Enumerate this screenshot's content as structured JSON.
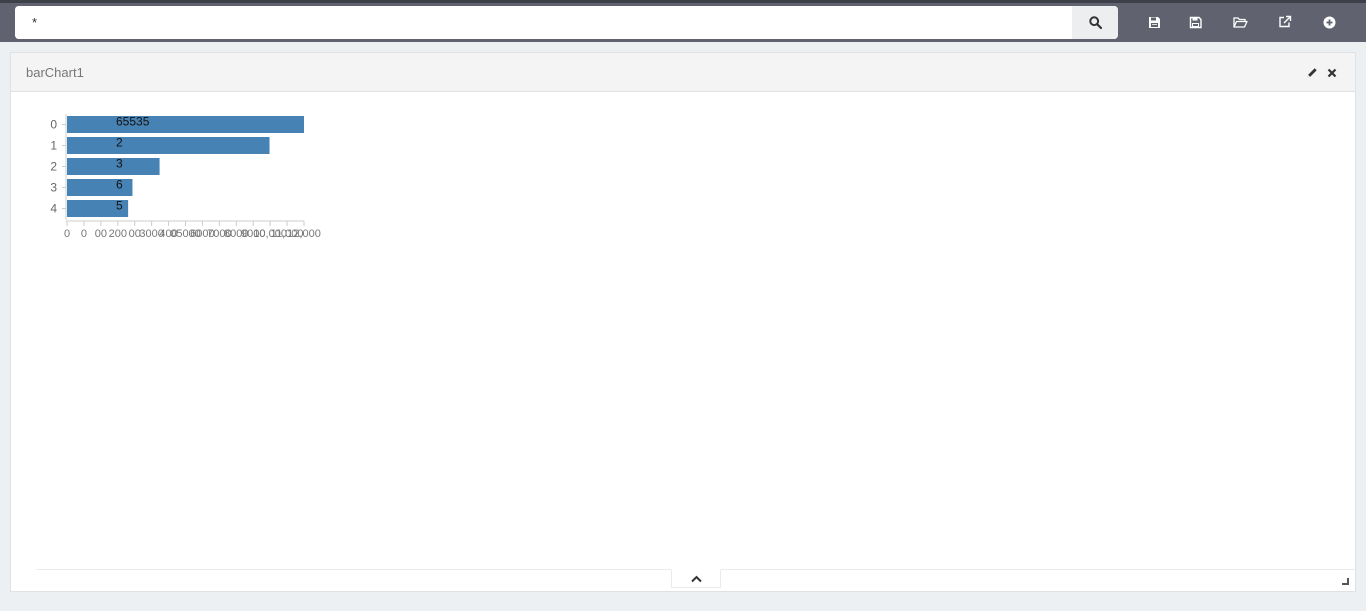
{
  "search": {
    "value": "*"
  },
  "panel": {
    "title": "barChart1"
  },
  "chart_data": {
    "type": "bar",
    "orientation": "horizontal",
    "categories": [
      "0",
      "1",
      "2",
      "3",
      "4"
    ],
    "values": [
      65535,
      56000,
      25600,
      18100,
      16900
    ],
    "value_labels": [
      "65535",
      "2",
      "3",
      "6",
      "5"
    ],
    "x_tick_labels": [
      "0",
      "0",
      "00",
      "200",
      "00",
      "3000",
      "400",
      "05000",
      "6000",
      "7000",
      "8000",
      "9000",
      "10,000",
      "11,000",
      "12,000"
    ],
    "xlim": [
      0,
      65535
    ],
    "bar_color": "#4682b4",
    "title": "",
    "xlabel": "",
    "ylabel": ""
  }
}
